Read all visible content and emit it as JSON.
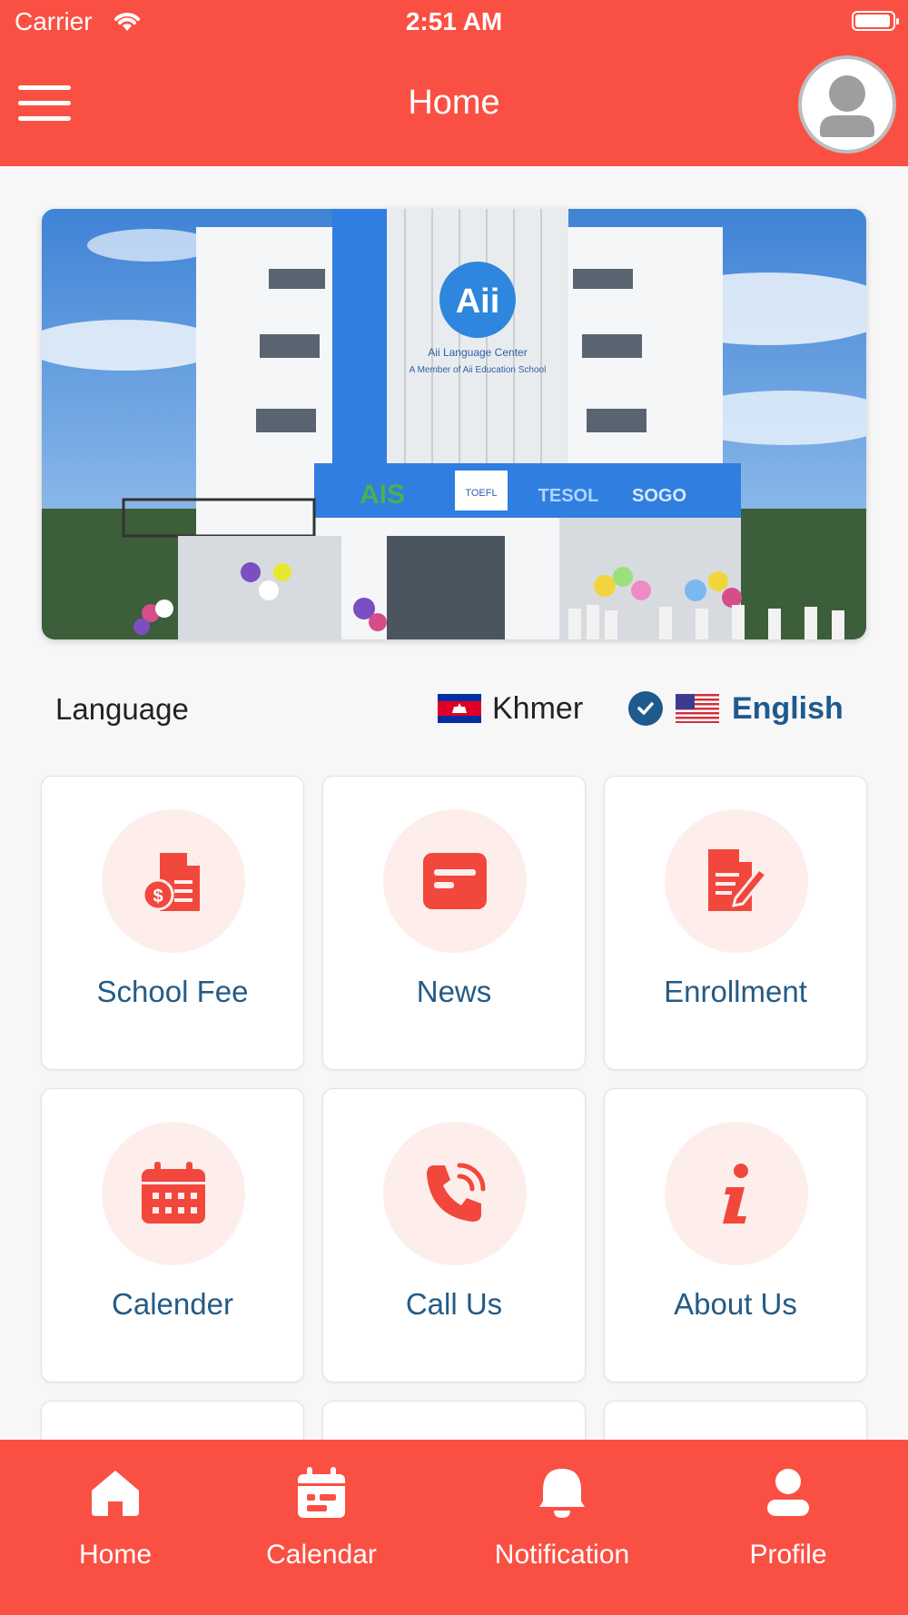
{
  "status": {
    "carrier": "Carrier",
    "time": "2:51 AM"
  },
  "header": {
    "title": "Home"
  },
  "language": {
    "label": "Language",
    "options": [
      {
        "name": "Khmer",
        "selected": false
      },
      {
        "name": "English",
        "selected": true
      }
    ]
  },
  "hero": {
    "sign_logo": "Aii",
    "sign_line1": "Aii Language Center",
    "sign_line2": "A Member of Aii Education School",
    "banner_marks": [
      "AIS",
      "TOEFL",
      "TESOL",
      "SOGO"
    ]
  },
  "tiles": [
    {
      "label": "School Fee",
      "icon": "invoice-dollar-icon"
    },
    {
      "label": "News",
      "icon": "news-window-icon"
    },
    {
      "label": "Enrollment",
      "icon": "document-pen-icon"
    },
    {
      "label": "Calender",
      "icon": "calendar-icon"
    },
    {
      "label": "Call Us",
      "icon": "phone-call-icon"
    },
    {
      "label": "About Us",
      "icon": "info-icon"
    }
  ],
  "bottom_nav": [
    {
      "label": "Home",
      "icon": "home-icon"
    },
    {
      "label": "Calendar",
      "icon": "calendar-icon"
    },
    {
      "label": "Notification",
      "icon": "bell-icon"
    },
    {
      "label": "Profile",
      "icon": "user-icon"
    }
  ],
  "colors": {
    "primary": "#fa5043",
    "accent_text": "#245b86",
    "check": "#1f5a8e",
    "tile_circle": "#fdeeec"
  }
}
